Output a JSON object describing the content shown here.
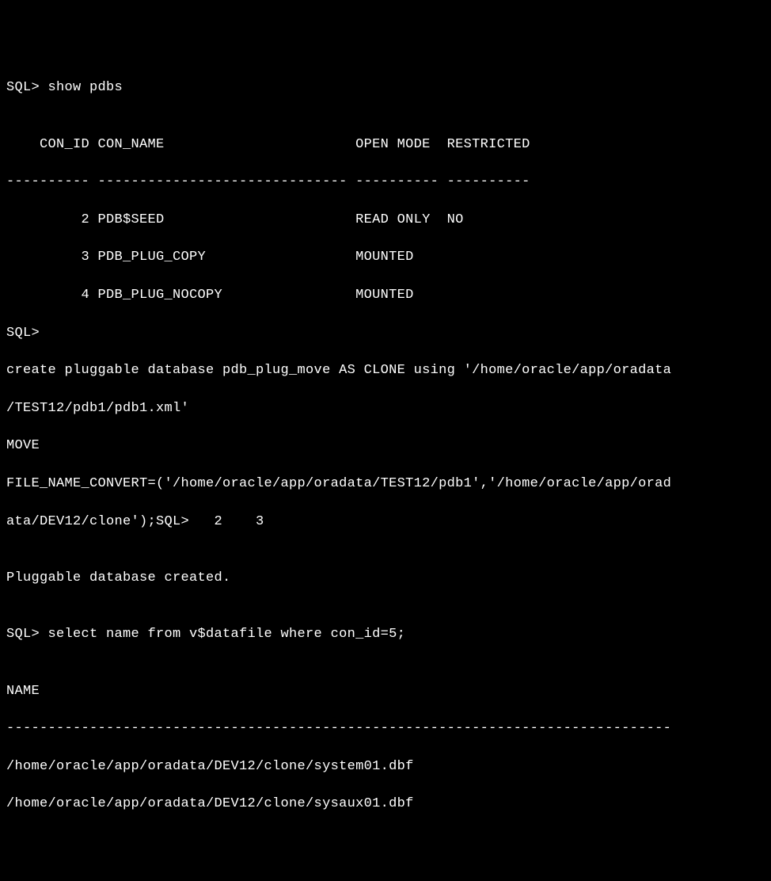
{
  "lines": {
    "l0": "SQL> show pdbs",
    "l1": "",
    "l2": "    CON_ID CON_NAME                       OPEN MODE  RESTRICTED",
    "l3": "---------- ------------------------------ ---------- ----------",
    "l4": "         2 PDB$SEED                       READ ONLY  NO",
    "l5": "         3 PDB_PLUG_COPY                  MOUNTED",
    "l6": "         4 PDB_PLUG_NOCOPY                MOUNTED",
    "l7": "SQL>",
    "l8": "create pluggable database pdb_plug_move AS CLONE using '/home/oracle/app/oradata",
    "l9": "/TEST12/pdb1/pdb1.xml'",
    "l10": "MOVE",
    "l11": "FILE_NAME_CONVERT=('/home/oracle/app/oradata/TEST12/pdb1','/home/oracle/app/orad",
    "l12": "ata/DEV12/clone');SQL>   2    3",
    "l13": "",
    "l14": "Pluggable database created.",
    "l15": "",
    "l16": "SQL> select name from v$datafile where con_id=5;",
    "l17": "",
    "l18": "NAME",
    "l19": "--------------------------------------------------------------------------------",
    "l20": "/home/oracle/app/oradata/DEV12/clone/system01.dbf",
    "l21": "/home/oracle/app/oradata/DEV12/clone/sysaux01.dbf"
  }
}
